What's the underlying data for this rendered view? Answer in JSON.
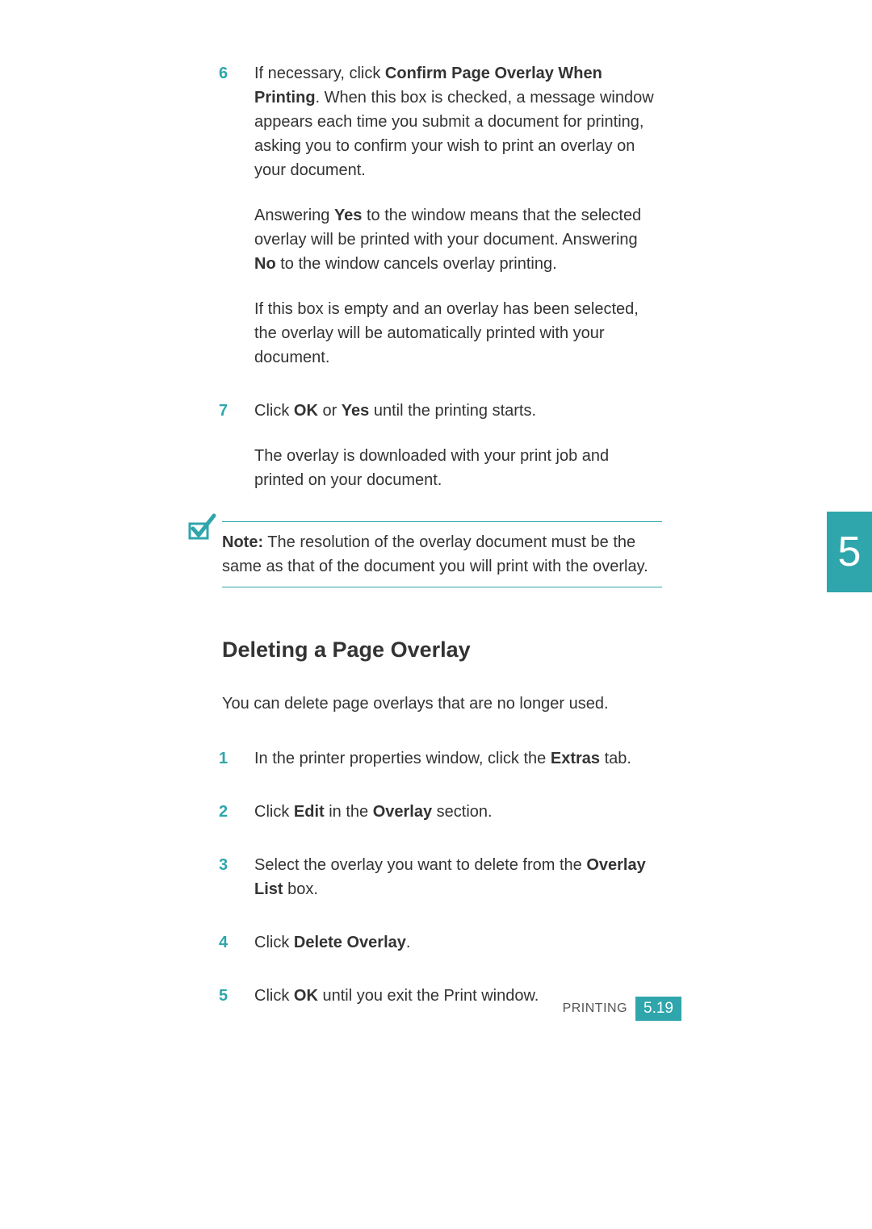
{
  "chapter_tab": "5",
  "footer": {
    "label": "PRINTING",
    "page": "5.19"
  },
  "sec1": {
    "step6": {
      "num": "6",
      "p1_pre": "If necessary, click ",
      "p1_bold": "Confirm Page Overlay When Printing",
      "p1_post": ". When this box is checked, a message window appears each time you submit a document for printing, asking you to confirm your wish to print an overlay on your document.",
      "p2_pre": "Answering ",
      "p2_b1": "Yes",
      "p2_mid": " to the window means that the selected overlay will be printed with your document. Answering ",
      "p2_b2": "No",
      "p2_post": " to the window cancels overlay printing.",
      "p3": "If this box is empty and an overlay has been selected, the overlay will be automatically printed with your document."
    },
    "step7": {
      "num": "7",
      "p1_pre": "Click ",
      "p1_b1": "OK",
      "p1_mid": " or ",
      "p1_b2": "Yes",
      "p1_post": " until the printing starts.",
      "p2": "The overlay is downloaded with your print job and printed on your document."
    },
    "note": {
      "label": "Note:",
      "text": " The resolution of the overlay document must be the same as that of the document you will print with the overlay."
    }
  },
  "sec2": {
    "heading": "Deleting a Page Overlay",
    "intro": "You can delete page overlays that are no longer used.",
    "step1": {
      "num": "1",
      "pre": "In the printer properties window, click the ",
      "b1": "Extras",
      "post": " tab."
    },
    "step2": {
      "num": "2",
      "pre": "Click ",
      "b1": "Edit",
      "mid": " in the ",
      "b2": "Overlay",
      "post": " section."
    },
    "step3": {
      "num": "3",
      "pre": "Select the overlay you want to delete from the ",
      "b1": "Overlay List",
      "post": " box."
    },
    "step4": {
      "num": "4",
      "pre": "Click ",
      "b1": "Delete Overlay",
      "post": "."
    },
    "step5": {
      "num": "5",
      "pre": "Click ",
      "b1": "OK",
      "post": " until you exit the Print window."
    }
  }
}
